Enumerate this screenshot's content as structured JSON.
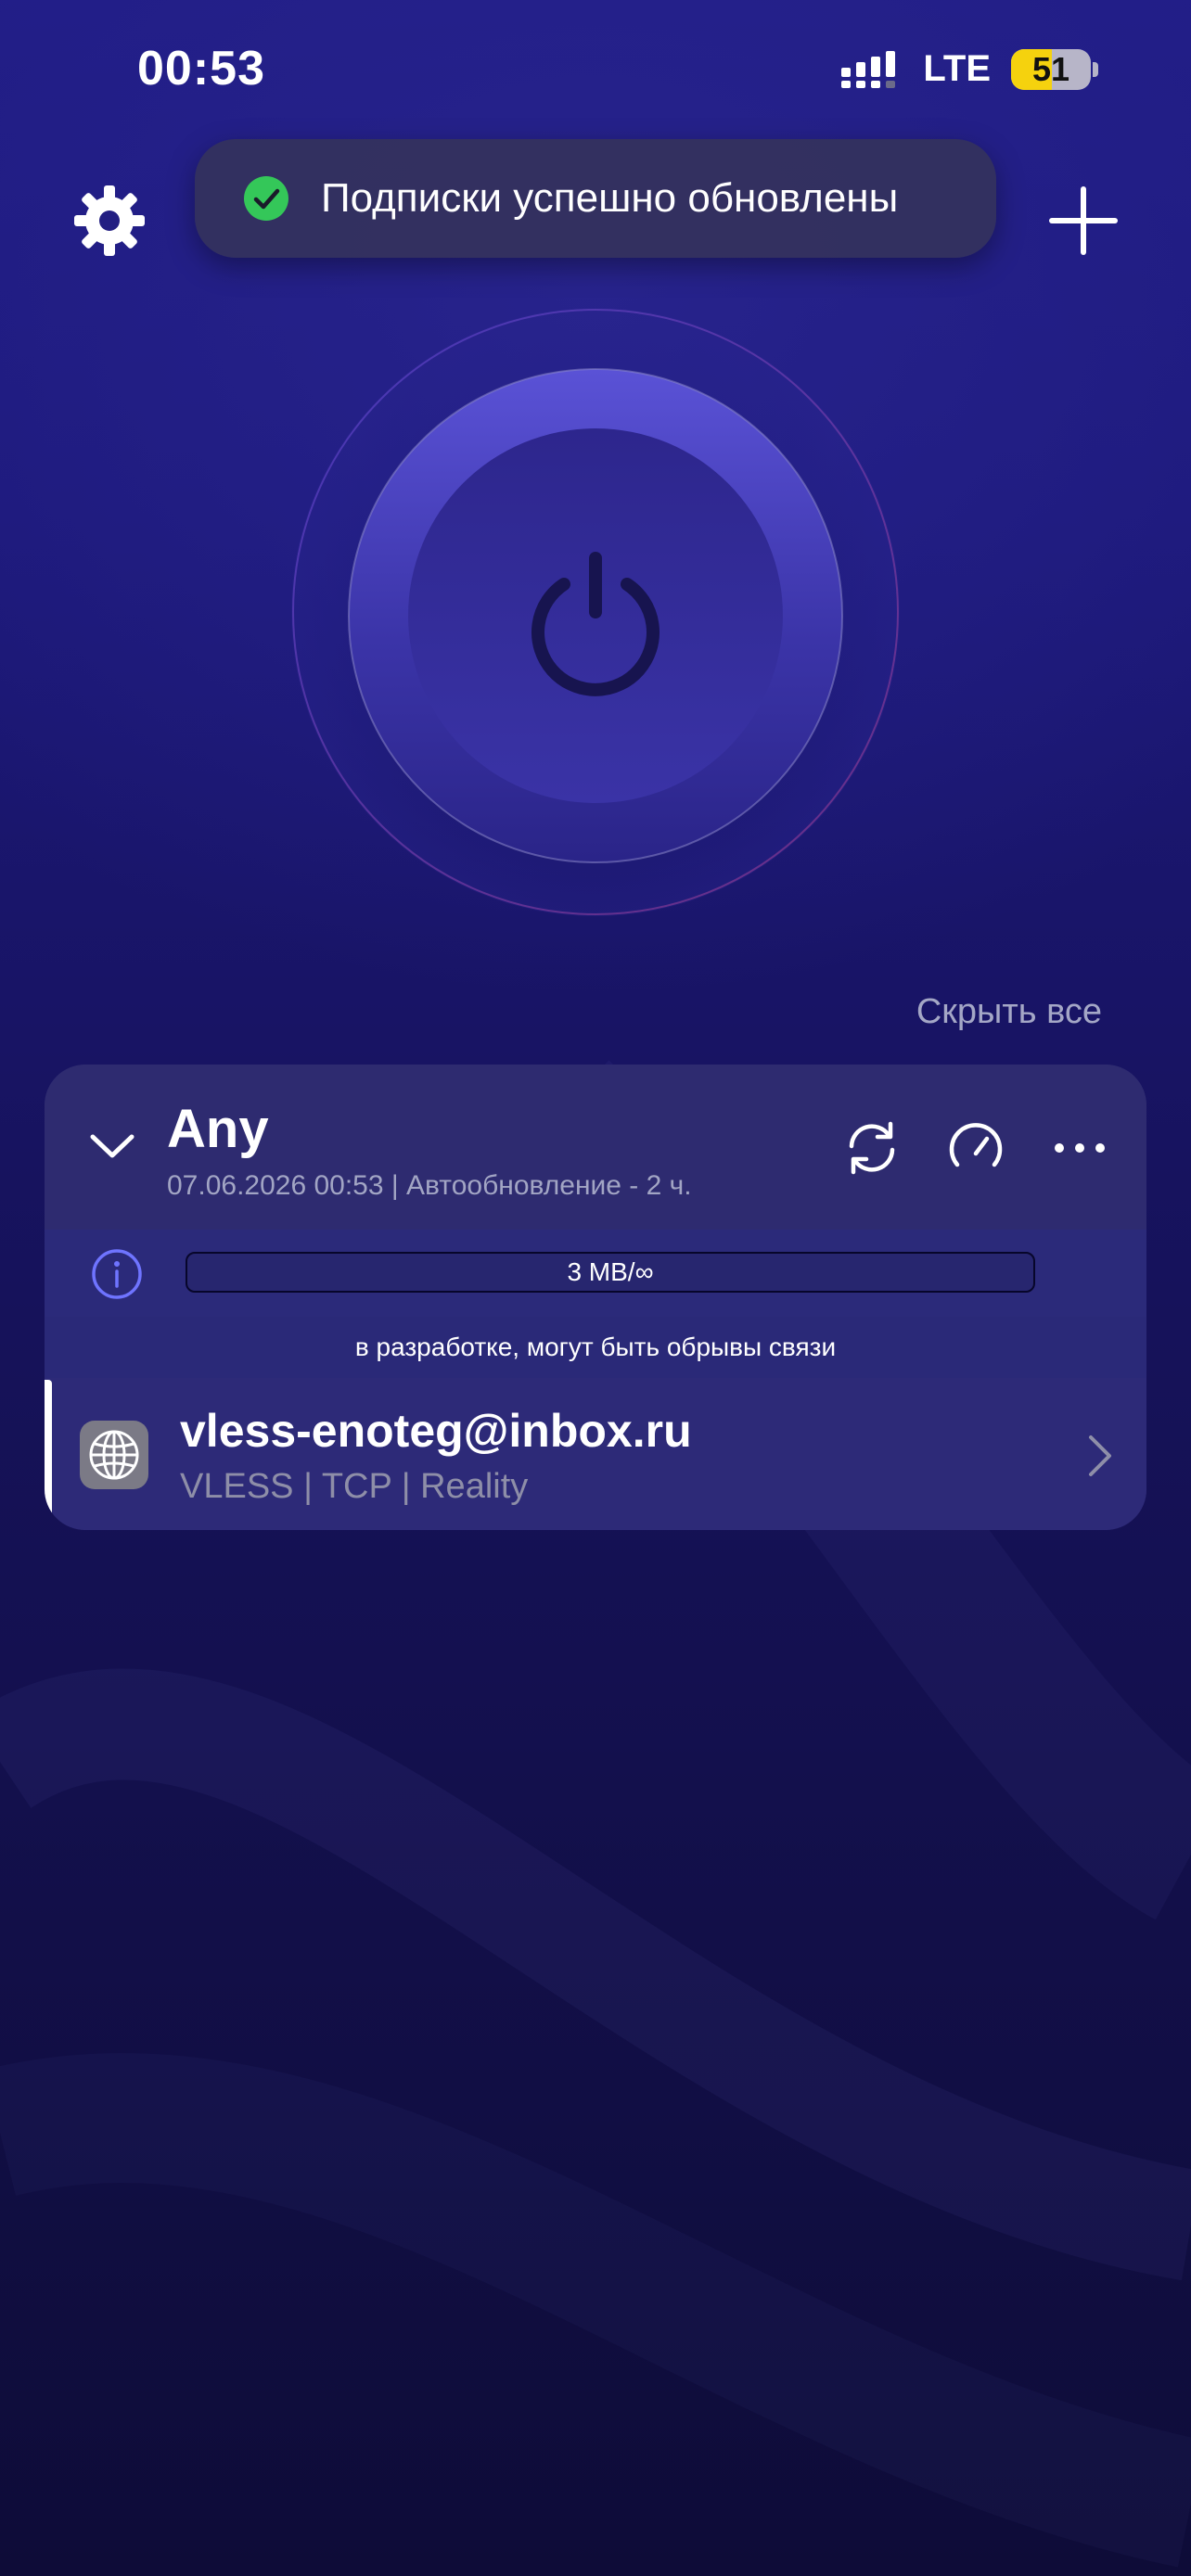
{
  "status_bar": {
    "time": "00:53",
    "network": "LTE",
    "battery": "51",
    "battery_level": 0.51
  },
  "toast": {
    "message": "Подписки успешно обновлены",
    "icon": "check-circle-icon"
  },
  "header": {
    "settings_icon": "gear-icon",
    "add_icon": "plus-icon"
  },
  "power": {
    "icon": "power-icon"
  },
  "hide_all_label": "Скрыть все",
  "subscription": {
    "title": "Any",
    "subtitle": "07.06.2026 00:53 | Автообновление - 2 ч.",
    "usage": "3 MB/∞",
    "notice": "в разработке, могут быть обрывы связи",
    "actions": [
      "refresh-icon",
      "speedometer-icon",
      "more-icon"
    ]
  },
  "server": {
    "name": "vless-enoteg@inbox.ru",
    "protocol": "VLESS | TCP | Reality",
    "icon": "globe-icon"
  },
  "colors": {
    "background": "#1c187a",
    "card": "#2a2770",
    "accent": "#4a44c4",
    "toast_check": "#34c759",
    "battery": "#f5d20e"
  }
}
